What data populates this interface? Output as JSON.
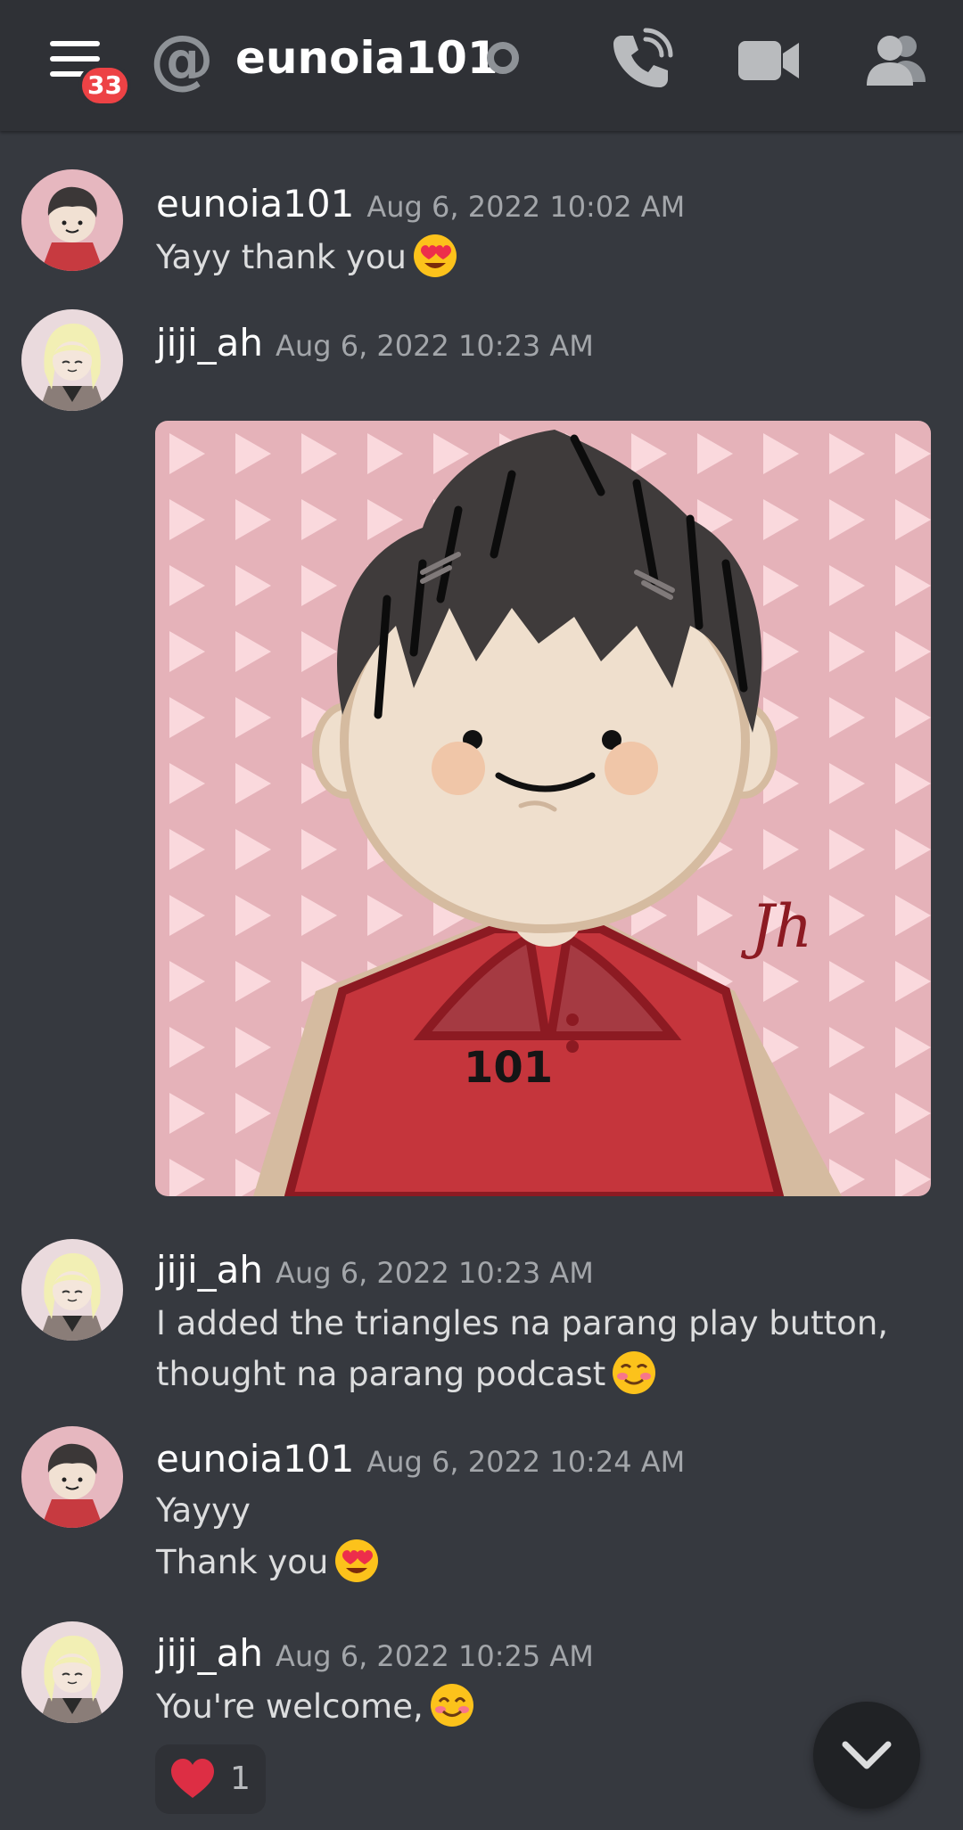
{
  "header": {
    "menu_label": "Open menu",
    "badge_count": "33",
    "title": "eunoia101",
    "icons": [
      "menu-icon",
      "at-icon",
      "status-idle-icon",
      "phone-call-icon",
      "video-camera-icon",
      "members-icon"
    ]
  },
  "colors": {
    "background": "#36393f",
    "header": "#2f3136",
    "badge": "#ed4245",
    "username": "#ffffff",
    "timestamp": "#a3a6aa",
    "text": "#dcddde"
  },
  "messages": [
    {
      "author": "eunoia101",
      "timestamp": "Aug 6, 2022 10:02 AM",
      "lines": [
        "Yayy thank you"
      ],
      "emoji": "heart-eyes-emoji"
    },
    {
      "author": "jiji_ah",
      "timestamp": "Aug 6, 2022 10:23 AM",
      "lines": [],
      "attachment": "avatar-illustration-image"
    },
    {
      "author": "jiji_ah",
      "timestamp": "Aug 6, 2022 10:23 AM",
      "lines": [
        "I added the triangles na parang play button,",
        "thought na parang podcast"
      ],
      "emoji": "smiling-blush-emoji"
    },
    {
      "author": "eunoia101",
      "timestamp": "Aug 6, 2022 10:24 AM",
      "lines": [
        "Yayyy",
        "Thank you"
      ],
      "emoji": "heart-eyes-emoji"
    },
    {
      "author": "jiji_ah",
      "timestamp": "Aug 6, 2022 10:25 AM",
      "lines": [
        "You're welcome,"
      ],
      "emoji": "smiling-eyes-emoji"
    }
  ],
  "reaction": {
    "icon": "heart-icon",
    "count": "1"
  },
  "attachment_text": {
    "shirt_number": "101",
    "signature": "Jh"
  },
  "scroll_button_icon": "chevron-down-icon"
}
